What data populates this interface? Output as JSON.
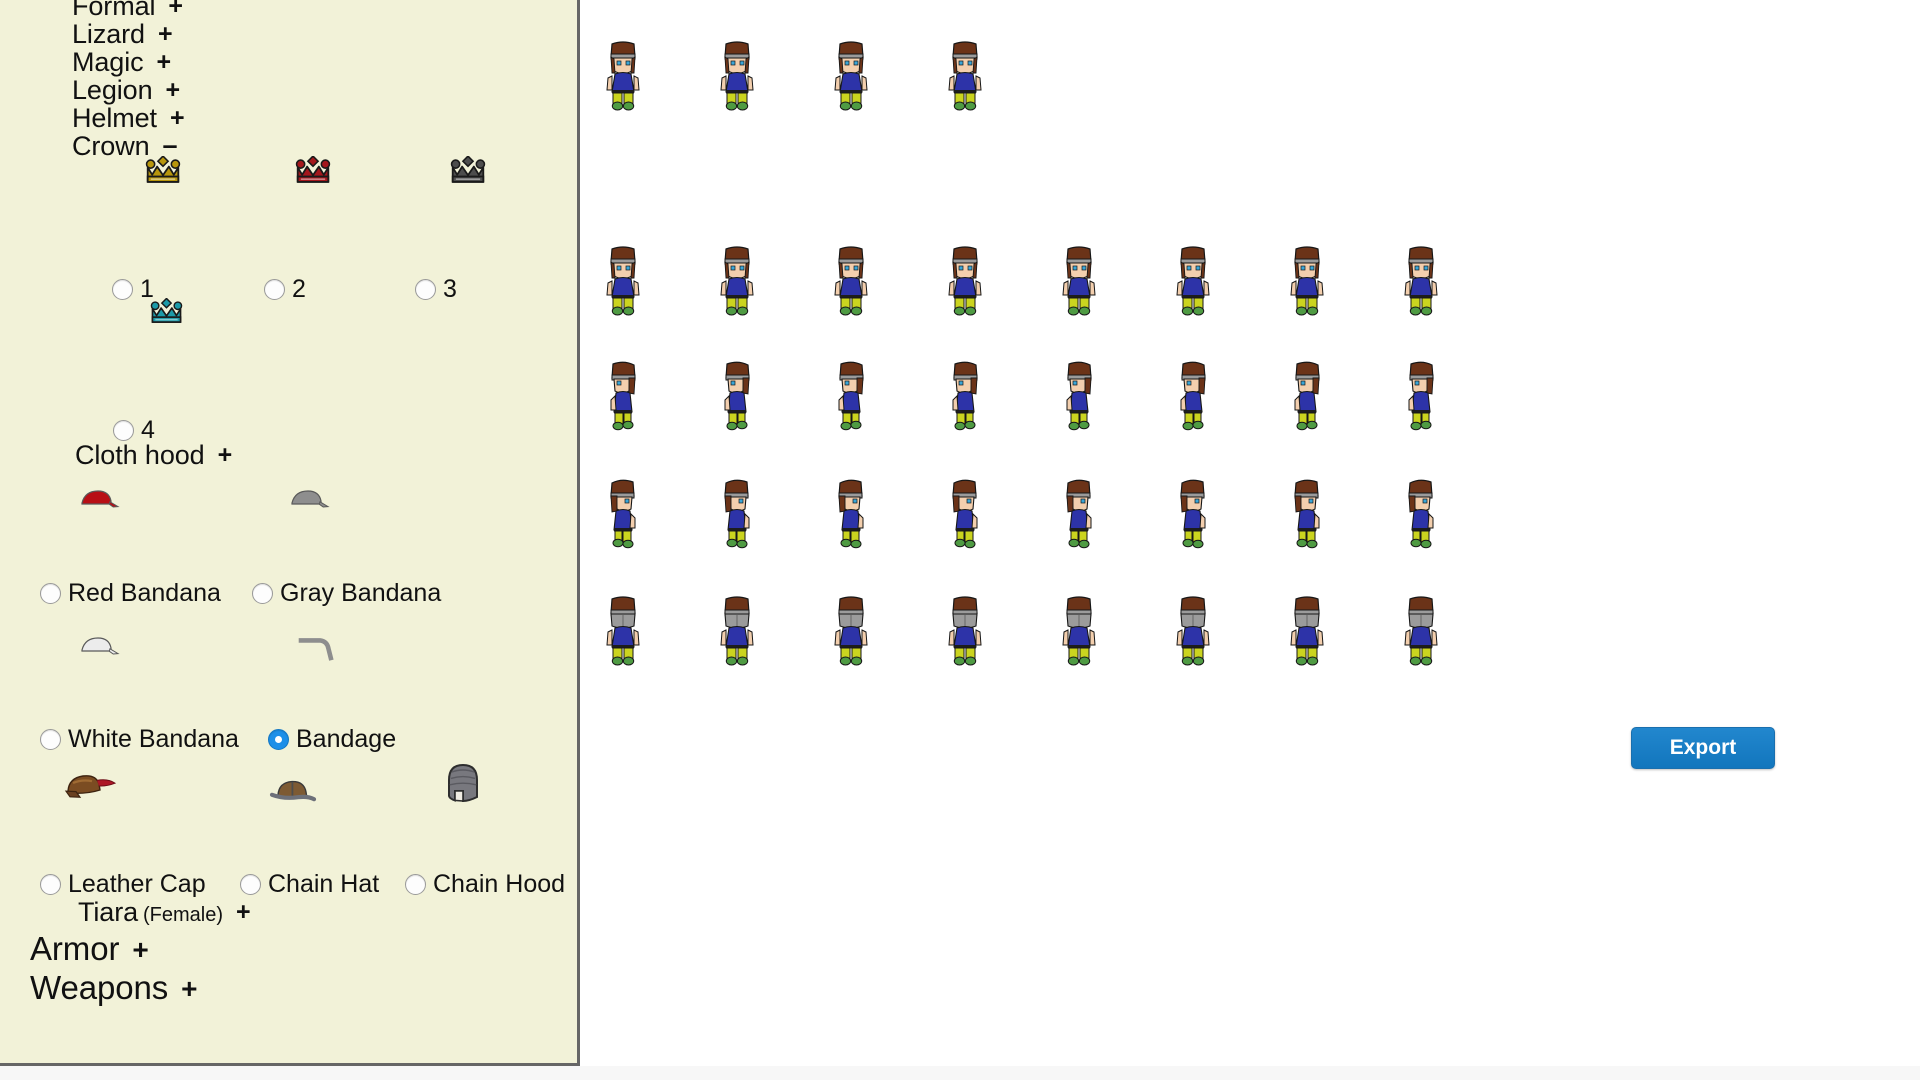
{
  "app": {
    "sidebar_bg": "#f2f2d8",
    "accent": "#1d8fe8",
    "export_label": "Export"
  },
  "sidebar": {
    "tree": [
      {
        "label": "Formal",
        "toggle": "+",
        "state": "collapsed",
        "level": 1
      },
      {
        "label": "Lizard",
        "toggle": "+",
        "state": "collapsed",
        "level": 1
      },
      {
        "label": "Magic",
        "toggle": "+",
        "state": "collapsed",
        "level": 1
      },
      {
        "label": "Legion",
        "toggle": "+",
        "state": "collapsed",
        "level": 1
      },
      {
        "label": "Helmet",
        "toggle": "+",
        "state": "collapsed",
        "level": 1
      },
      {
        "label": "Crown",
        "toggle": "–",
        "state": "expanded",
        "level": 1
      }
    ],
    "crown_options": [
      {
        "label": "1",
        "icon": "crown-gold-icon",
        "color": "#b8960c",
        "selected": false
      },
      {
        "label": "2",
        "icon": "crown-red-icon",
        "color": "#a4171c",
        "selected": false
      },
      {
        "label": "3",
        "icon": "crown-black-icon",
        "color": "#4d4d4d",
        "selected": false
      },
      {
        "label": "4",
        "icon": "crown-teal-icon",
        "color": "#1d9aa8",
        "selected": false
      }
    ],
    "cloth_hood": {
      "label": "Cloth hood",
      "toggle": "+",
      "state": "collapsed"
    },
    "hood_options": [
      {
        "label": "Red Bandana",
        "icon": "bandana-red-icon",
        "color": "#b80f15",
        "selected": false
      },
      {
        "label": "Gray Bandana",
        "icon": "bandana-gray-icon",
        "color": "#8e8e8e",
        "selected": false
      },
      {
        "label": "White Bandana",
        "icon": "bandana-white-icon",
        "color": "#ececec",
        "selected": false
      },
      {
        "label": "Bandage",
        "icon": "bandage-icon",
        "color": "#8e8e8e",
        "selected": true
      },
      {
        "label": "Leather Cap",
        "icon": "leather-cap-icon",
        "color": "#7b4c22",
        "selected": false
      },
      {
        "label": "Chain Hat",
        "icon": "chain-hat-icon",
        "color": "#6b6f78",
        "selected": false
      },
      {
        "label": "Chain Hood",
        "icon": "chain-hood-icon",
        "color": "#78787e",
        "selected": false
      }
    ],
    "tiara": {
      "label": "Tiara",
      "sub": "(Female)",
      "toggle": "+",
      "state": "collapsed"
    },
    "sections": [
      {
        "label": "Armor",
        "toggle": "+",
        "state": "collapsed"
      },
      {
        "label": "Weapons",
        "toggle": "+",
        "state": "collapsed"
      }
    ]
  },
  "preview": {
    "sprite": {
      "hair": "#6b3318",
      "headband": "#9b9b9b",
      "skin": "#f3cfae",
      "shirt": "#2d33a8",
      "pants": "#cbd41f",
      "shoes": "#4f9b43",
      "eyes": "#3aa6d8",
      "belt": "#1d1d1d"
    },
    "rows": [
      {
        "name": "walk-down-row",
        "count": 4,
        "facing": "front"
      },
      {
        "name": "stand-row",
        "count": 8,
        "facing": "front"
      },
      {
        "name": "walk-left-row",
        "count": 8,
        "facing": "left"
      },
      {
        "name": "walk-right-row",
        "count": 8,
        "facing": "right"
      },
      {
        "name": "walk-up-row",
        "count": 8,
        "facing": "back"
      }
    ]
  }
}
